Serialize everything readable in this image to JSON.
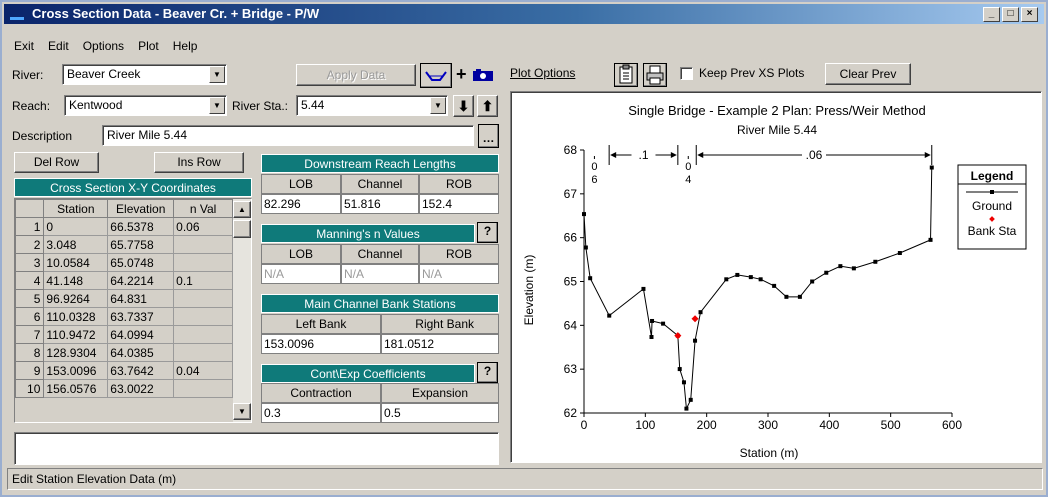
{
  "window": {
    "title": "Cross Section Data - Beaver Cr. + Bridge - P/W",
    "minimize": "_",
    "maximize": "□",
    "close": "×"
  },
  "menu": [
    "Exit",
    "Edit",
    "Options",
    "Plot",
    "Help"
  ],
  "river": {
    "label": "River:",
    "value": "Beaver Creek"
  },
  "reach": {
    "label": "Reach:",
    "value": "Kentwood"
  },
  "river_sta": {
    "label": "River Sta.:",
    "value": "5.44"
  },
  "description": {
    "label": "Description",
    "value": "River Mile 5.44"
  },
  "buttons": {
    "apply_data": "Apply Data",
    "del_row": "Del Row",
    "ins_row": "Ins Row",
    "plot_options": "Plot Options",
    "keep_prev": "Keep Prev XS Plots",
    "clear_prev": "Clear Prev",
    "help": "?"
  },
  "xs_table": {
    "title": "Cross Section X-Y Coordinates",
    "headers": [
      "Station",
      "Elevation",
      "n Val"
    ],
    "rows": [
      {
        "n": "1",
        "station": "0",
        "elev": "66.5378",
        "nval": "0.06"
      },
      {
        "n": "2",
        "station": "3.048",
        "elev": "65.7758",
        "nval": ""
      },
      {
        "n": "3",
        "station": "10.0584",
        "elev": "65.0748",
        "nval": ""
      },
      {
        "n": "4",
        "station": "41.148",
        "elev": "64.2214",
        "nval": "0.1"
      },
      {
        "n": "5",
        "station": "96.9264",
        "elev": "64.831",
        "nval": ""
      },
      {
        "n": "6",
        "station": "110.0328",
        "elev": "63.7337",
        "nval": ""
      },
      {
        "n": "7",
        "station": "110.9472",
        "elev": "64.0994",
        "nval": ""
      },
      {
        "n": "8",
        "station": "128.9304",
        "elev": "64.0385",
        "nval": ""
      },
      {
        "n": "9",
        "station": "153.0096",
        "elev": "63.7642",
        "nval": "0.04"
      },
      {
        "n": "10",
        "station": "156.0576",
        "elev": "63.0022",
        "nval": ""
      }
    ]
  },
  "downstream": {
    "title": "Downstream Reach Lengths",
    "headers": [
      "LOB",
      "Channel",
      "ROB"
    ],
    "values": [
      "82.296",
      "51.816",
      "152.4"
    ]
  },
  "mannings": {
    "title": "Manning's n Values",
    "headers": [
      "LOB",
      "Channel",
      "ROB"
    ],
    "values": [
      "N/A",
      "N/A",
      "N/A"
    ]
  },
  "bank": {
    "title": "Main Channel Bank Stations",
    "headers": [
      "Left Bank",
      "Right Bank"
    ],
    "values": [
      "153.0096",
      "181.0512"
    ]
  },
  "coeff": {
    "title": "Cont\\Exp  Coefficients",
    "headers": [
      "Contraction",
      "Expansion"
    ],
    "values": [
      "0.3",
      "0.5"
    ]
  },
  "status": "Edit Station Elevation Data (m)",
  "colors": {
    "teal": "#0f7a7a",
    "ground": "#000000",
    "bank": "#ee0000"
  },
  "chart_data": {
    "type": "line",
    "title": "Single Bridge - Example 2     Plan: Press/Weir Method",
    "subtitle": "River Mile 5.44",
    "xlabel": "Station (m)",
    "ylabel": "Elevation (m)",
    "xlim": [
      0,
      600
    ],
    "ylim": [
      62,
      68
    ],
    "xticks": [
      "0",
      "100",
      "200",
      "300",
      "400",
      "500",
      "600"
    ],
    "yticks": [
      "62",
      "63",
      "64",
      "65",
      "66",
      "67",
      "68"
    ],
    "legend": {
      "title": "Legend",
      "entries": [
        "Ground",
        "Bank Sta"
      ],
      "position": "right"
    },
    "series": [
      {
        "name": "Ground",
        "x": [
          0,
          3.048,
          10.0584,
          41.148,
          96.9264,
          110.0328,
          110.9472,
          128.9304,
          153.0096,
          156.0576,
          163,
          167,
          174,
          181.0512,
          190,
          232,
          250,
          272,
          288,
          310,
          330,
          352,
          372,
          395,
          418,
          440,
          475,
          515,
          565,
          567
        ],
        "y": [
          66.5378,
          65.7758,
          65.0748,
          64.2214,
          64.831,
          63.7337,
          64.0994,
          64.0385,
          63.7642,
          63.0022,
          62.7,
          62.1,
          62.3,
          63.65,
          64.3,
          65.05,
          65.15,
          65.1,
          65.05,
          64.9,
          64.65,
          64.65,
          65.0,
          65.2,
          65.35,
          65.3,
          65.45,
          65.65,
          65.95,
          67.6
        ]
      },
      {
        "name": "Bank Sta",
        "x": [
          153.0096,
          181.0512
        ],
        "y": [
          63.7642,
          64.15
        ]
      }
    ],
    "annotations": [
      {
        "x": 17,
        "label": "0\n6"
      },
      {
        "x": 170,
        "label": "0\n4"
      },
      {
        "from": 41,
        "to": 153,
        "label": ".1"
      },
      {
        "from": 183,
        "to": 567,
        "label": ".06"
      }
    ]
  }
}
